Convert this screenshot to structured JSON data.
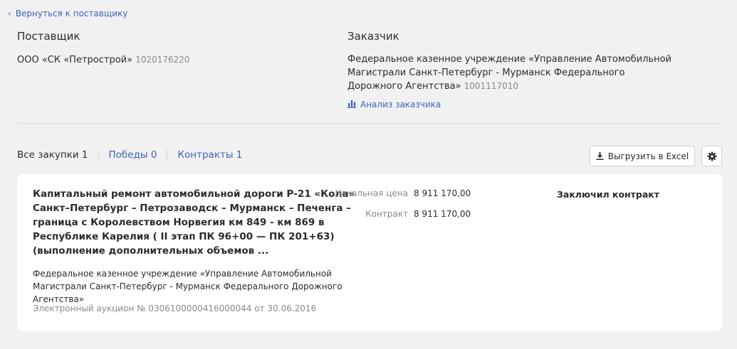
{
  "nav": {
    "back_label": "Вернуться к поставщику"
  },
  "supplier": {
    "heading": "Поставщик",
    "name": "ООО «СК «Петрострой»",
    "inn": "1020176220"
  },
  "customer": {
    "heading": "Заказчик",
    "name": "Федеральное казенное учреждение «Управление Автомобильной Магистрали Санкт-Петербург - Мурманск Федерального Дорожного Агентства»",
    "inn": "1001117010",
    "analysis_label": "Анализ заказчика"
  },
  "tabs": [
    {
      "label": "Все закупки 1",
      "active": true
    },
    {
      "label": "Победы 0",
      "active": false
    },
    {
      "label": "Контракты 1",
      "active": false
    }
  ],
  "toolbar": {
    "excel_label": "Выгрузить в Excel",
    "icons": {
      "excel": "download-icon",
      "settings": "gear-icon",
      "analysis": "bar-chart-icon",
      "back": "chevron-left-icon"
    }
  },
  "purchase": {
    "title": "Капитальный ремонт автомобильной дороги Р-21 «Кола» Санкт–Петербург – Петрозаводск – Мурманск – Печенга – граница с Королевством Норвегия км 849 - км 869 в Республике Карелия ( II этап ПК 96+00 — ПК 201+63) (выполнение дополнительных объемов ...",
    "customer": "Федеральное казенное учреждение «Управление Автомобильной Магистрали Санкт-Петербург - Мурманск Федерального Дорожного Агентства»",
    "auction": "Электронный аукцион № 0306100000416000044 от 30.06.2016",
    "initial_price_label": "Начальная цена",
    "initial_price": "8 911 170,00",
    "contract_label": "Контракт",
    "contract_price": "8 911 170,00",
    "status": "Заключил контракт"
  },
  "colors": {
    "accent": "#3a63b8",
    "background": "#f1f1f2",
    "card": "#ffffff",
    "muted": "#8a8a8a"
  }
}
